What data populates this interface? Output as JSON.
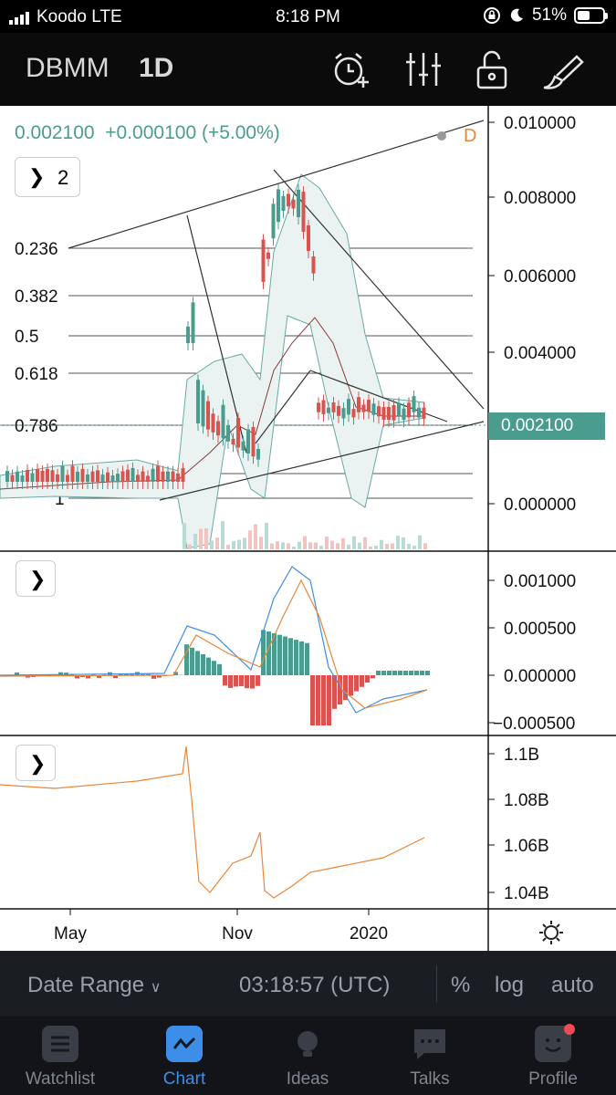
{
  "status": {
    "carrier": "Koodo LTE",
    "time": "8:18 PM",
    "battery": "51%",
    "battery_level": 0.51
  },
  "toolbar": {
    "symbol": "DBMM",
    "interval": "1D",
    "icons": [
      "alarm-add-icon",
      "indicators-icon",
      "unlock-icon",
      "draw-brush-icon"
    ]
  },
  "legend": {
    "price": "0.002100",
    "change": "+0.000100",
    "change_pct": "(+5.00%)",
    "source_tag": "D",
    "collapsed_count": "2"
  },
  "colors": {
    "up": "#4a9d8e",
    "down": "#d9534f",
    "accent": "#3d8ee8",
    "orange": "#e8863a"
  },
  "main_pane": {
    "price_axis": [
      "0.010000",
      "0.008000",
      "0.006000",
      "0.004000",
      "0.002100",
      "0.000000"
    ],
    "current_price_label": "0.002100",
    "fib_levels": [
      "0.236",
      "0.382",
      "0.5",
      "0.618",
      "0.786",
      "1",
      "1"
    ]
  },
  "macd_pane": {
    "axis": [
      "0.001000",
      "0.000500",
      "0.000000",
      "−0.000500"
    ]
  },
  "supply_pane": {
    "axis": [
      "1.1B",
      "1.08B",
      "1.06B",
      "1.04B"
    ]
  },
  "time_axis": [
    "May",
    "Nov",
    "2020"
  ],
  "range_bar": {
    "date_range": "Date Range",
    "clock": "03:18:57 (UTC)",
    "percent": "%",
    "log": "log",
    "auto": "auto"
  },
  "tabs": [
    {
      "label": "Watchlist",
      "icon": "watchlist-icon",
      "active": false
    },
    {
      "label": "Chart",
      "icon": "chart-icon",
      "active": true
    },
    {
      "label": "Ideas",
      "icon": "ideas-icon",
      "active": false
    },
    {
      "label": "Talks",
      "icon": "talks-icon",
      "active": false
    },
    {
      "label": "Profile",
      "icon": "profile-icon",
      "active": false
    }
  ]
}
